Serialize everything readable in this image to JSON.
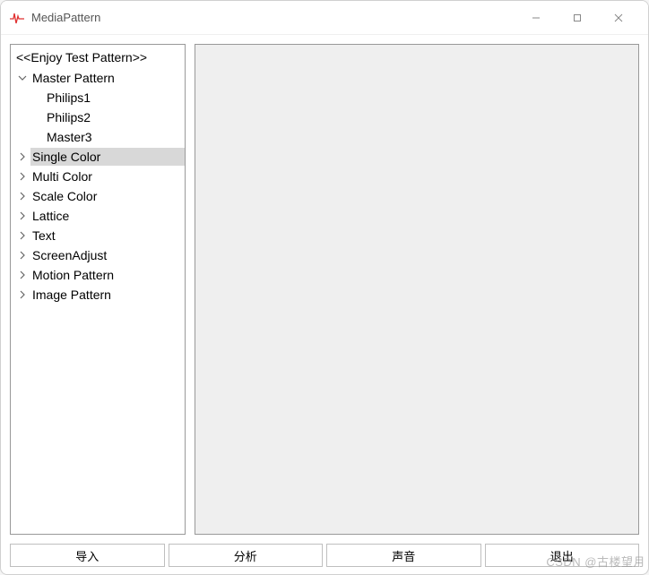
{
  "window": {
    "title": "MediaPattern"
  },
  "tree": {
    "header": "<<Enjoy Test Pattern>>",
    "items": [
      {
        "label": "Master Pattern",
        "expanded": true,
        "level": 1,
        "hasChildren": true,
        "selected": false
      },
      {
        "label": "Philips1",
        "expanded": false,
        "level": 2,
        "hasChildren": false,
        "selected": false
      },
      {
        "label": "Philips2",
        "expanded": false,
        "level": 2,
        "hasChildren": false,
        "selected": false
      },
      {
        "label": "Master3",
        "expanded": false,
        "level": 2,
        "hasChildren": false,
        "selected": false
      },
      {
        "label": "Single Color",
        "expanded": false,
        "level": 1,
        "hasChildren": true,
        "selected": true
      },
      {
        "label": "Multi Color",
        "expanded": false,
        "level": 1,
        "hasChildren": true,
        "selected": false
      },
      {
        "label": "Scale Color",
        "expanded": false,
        "level": 1,
        "hasChildren": true,
        "selected": false
      },
      {
        "label": "Lattice",
        "expanded": false,
        "level": 1,
        "hasChildren": true,
        "selected": false
      },
      {
        "label": "Text",
        "expanded": false,
        "level": 1,
        "hasChildren": true,
        "selected": false
      },
      {
        "label": "ScreenAdjust",
        "expanded": false,
        "level": 1,
        "hasChildren": true,
        "selected": false
      },
      {
        "label": "Motion Pattern",
        "expanded": false,
        "level": 1,
        "hasChildren": true,
        "selected": false
      },
      {
        "label": "Image Pattern",
        "expanded": false,
        "level": 1,
        "hasChildren": true,
        "selected": false
      }
    ]
  },
  "footer": {
    "buttons": [
      {
        "label": "导入"
      },
      {
        "label": "分析"
      },
      {
        "label": "声音"
      },
      {
        "label": "退出"
      }
    ]
  },
  "watermark": "CSDN @古楼望月"
}
